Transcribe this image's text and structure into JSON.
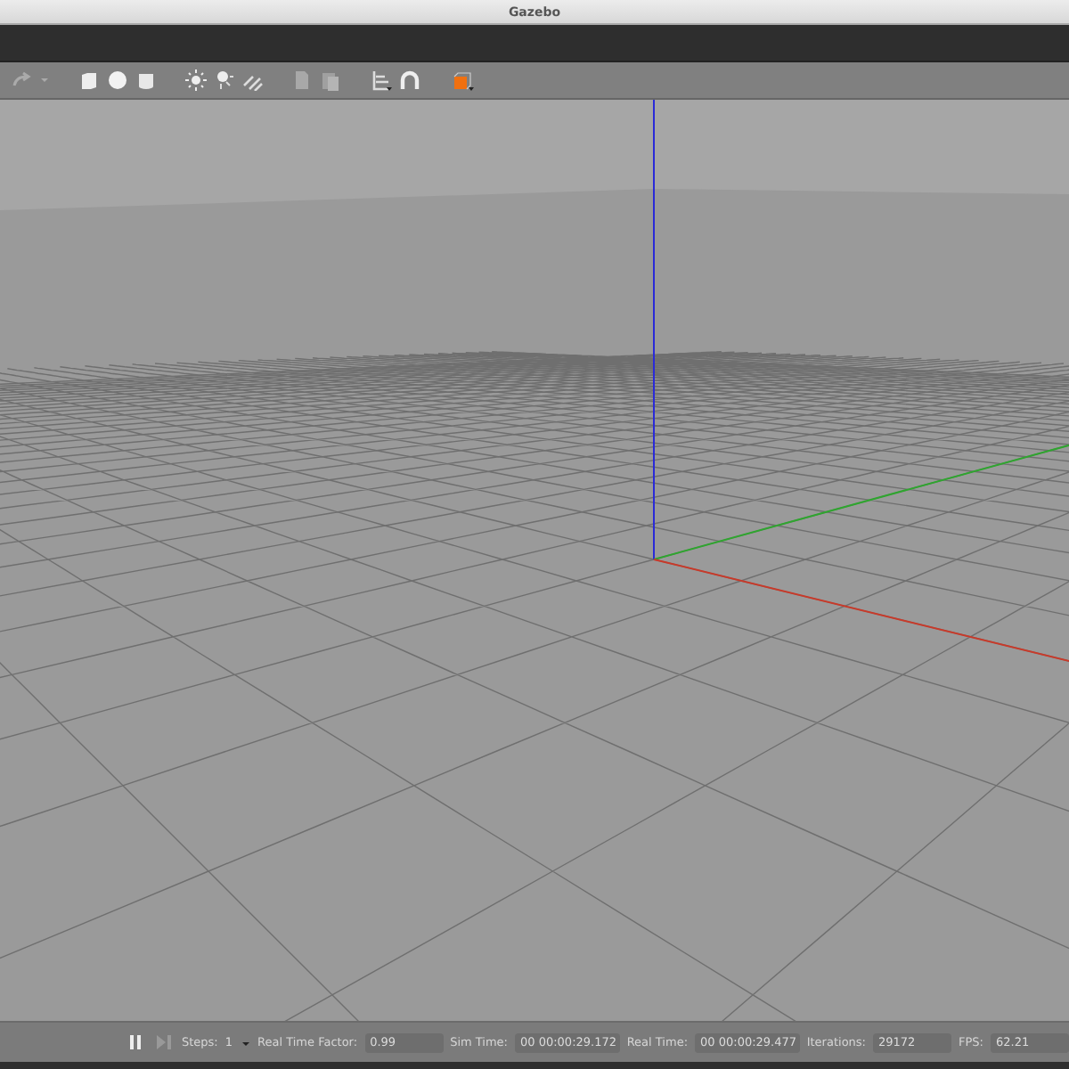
{
  "window": {
    "title": "Gazebo"
  },
  "bottom_bar": {
    "steps_label": "Steps:",
    "steps_value": "1",
    "fields": [
      {
        "label": "Real Time Factor:",
        "value": "0.99"
      },
      {
        "label": "Sim Time:",
        "value": "00 00:00:29.172"
      },
      {
        "label": "Real Time:",
        "value": "00 00:00:29.477"
      },
      {
        "label": "Iterations:",
        "value": "29172"
      },
      {
        "label": "FPS:",
        "value": "62.21"
      }
    ]
  }
}
